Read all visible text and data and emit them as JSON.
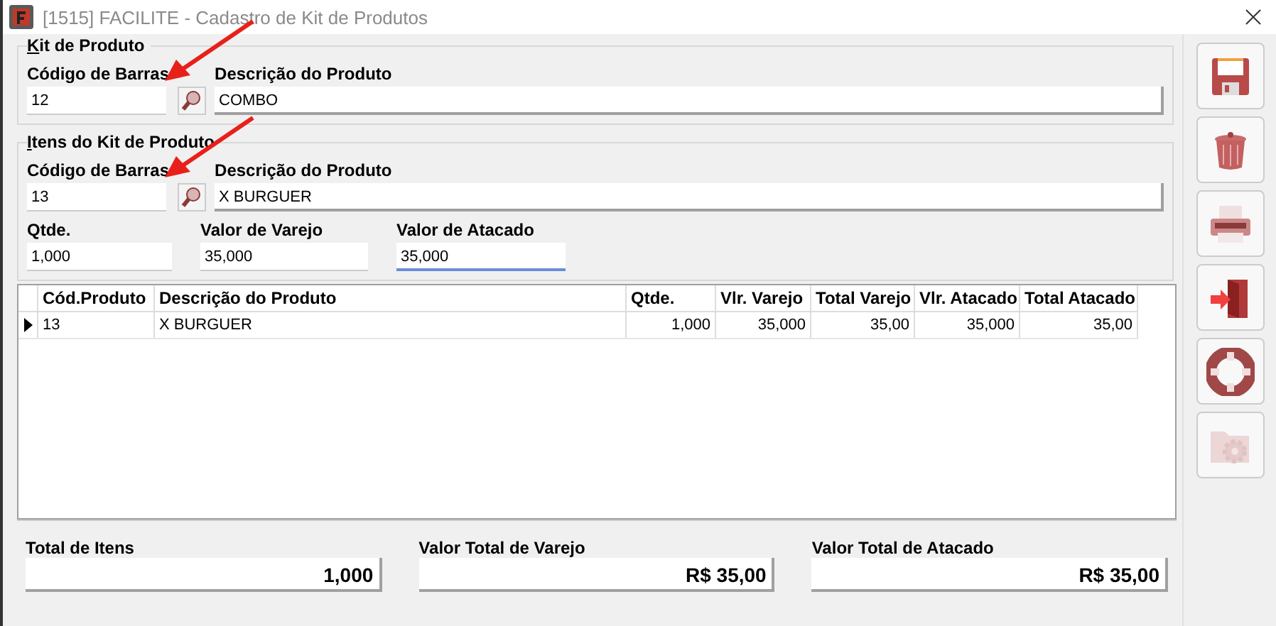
{
  "window": {
    "title": "[1515] FACILITE - Cadastro de Kit de Produtos"
  },
  "kit": {
    "title": "Kit de Produto",
    "barcode_label": "Código de Barras",
    "barcode": "12",
    "description_label": "Descrição do Produto",
    "description": "COMBO"
  },
  "items": {
    "title": "Itens do Kit de Produto",
    "barcode_label": "Código de Barras",
    "barcode": "13",
    "description_label": "Descrição do Produto",
    "description": "X BURGUER",
    "fields": [
      {
        "label": "Qtde.",
        "value": "1,000",
        "focused": false
      },
      {
        "label": "Valor de Varejo",
        "value": "35,000",
        "focused": false
      },
      {
        "label": "Valor de Atacado",
        "value": "35,000",
        "focused": true
      }
    ]
  },
  "table": {
    "columns": [
      "Cód.Produto",
      "Descrição do Produto",
      "Qtde.",
      "Vlr. Varejo",
      "Total Varejo",
      "Vlr. Atacado",
      "Total Atacado"
    ],
    "rows": [
      {
        "current": true,
        "cells": [
          "13",
          "X BURGUER",
          "1,000",
          "35,000",
          "35,00",
          "35,000",
          "35,00"
        ]
      }
    ]
  },
  "totals": [
    {
      "label": "Total de Itens",
      "value": "1,000"
    },
    {
      "label": "Valor Total de Varejo",
      "value": "R$ 35,00"
    },
    {
      "label": "Valor Total de Atacado",
      "value": "R$ 35,00"
    }
  ],
  "toolbar": [
    {
      "kind": "save",
      "disabled": false
    },
    {
      "kind": "delete",
      "disabled": false
    },
    {
      "kind": "print",
      "disabled": false
    },
    {
      "kind": "exit",
      "disabled": false
    },
    {
      "kind": "help",
      "disabled": false
    },
    {
      "kind": "settings",
      "disabled": true
    }
  ]
}
